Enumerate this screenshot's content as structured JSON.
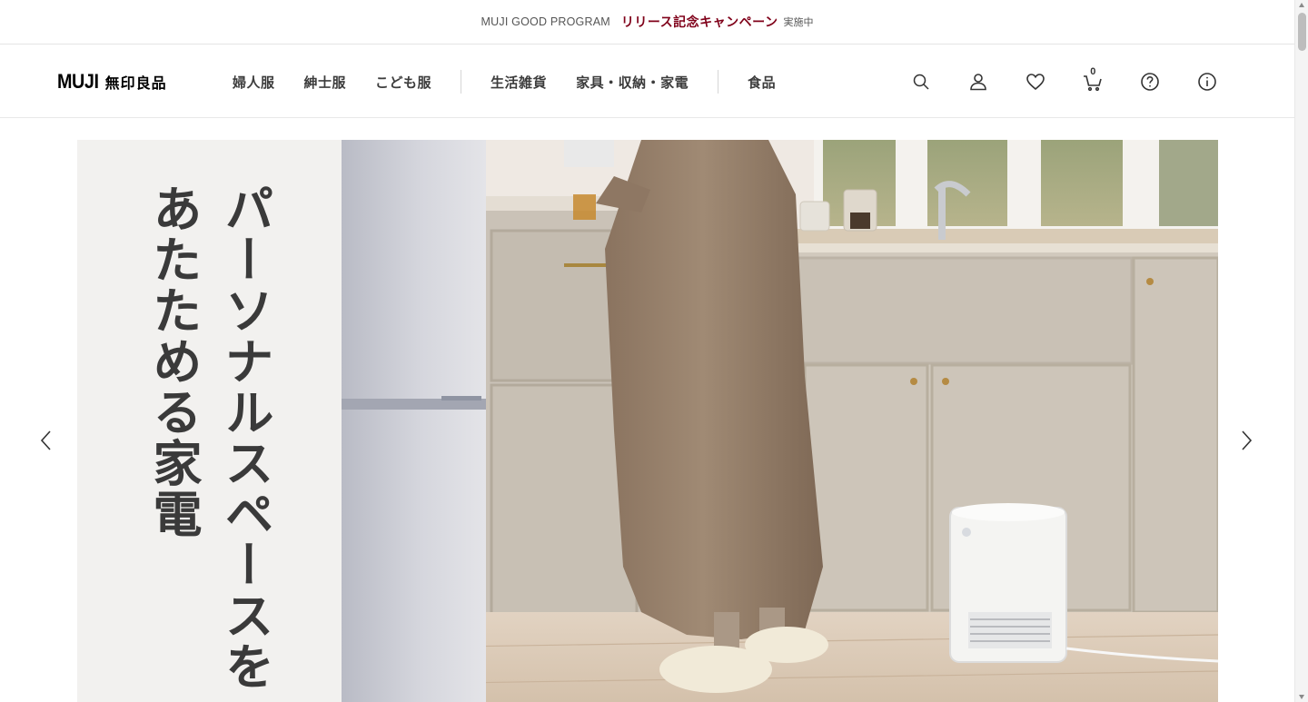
{
  "announcement": {
    "program": "MUJI GOOD PROGRAM",
    "campaign": "リリース記念キャンペーン",
    "status": "実施中",
    "campaign_color": "#7f0019"
  },
  "header": {
    "logo_en": "MUJI",
    "logo_jp": "無印良品",
    "nav": [
      {
        "label": "婦人服"
      },
      {
        "label": "紳士服"
      },
      {
        "label": "こども服"
      },
      {
        "label": "生活雑貨"
      },
      {
        "label": "家具・収納・家電"
      },
      {
        "label": "食品"
      }
    ],
    "icons": [
      "search-icon",
      "account-icon",
      "favorite-heart-icon",
      "cart-icon",
      "help-icon",
      "info-icon"
    ],
    "cart_count": "0"
  },
  "hero": {
    "headline_line1": "パーソナルスペースを",
    "headline_line2": "あたためる家電",
    "prev_icon": "chevron-left-icon",
    "next_icon": "chevron-right-icon"
  }
}
